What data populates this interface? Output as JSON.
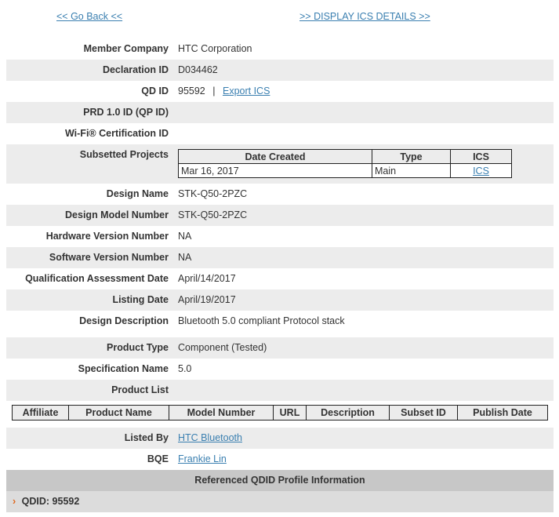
{
  "nav": {
    "back_label": "<< Go Back <<",
    "ics_label": ">> DISPLAY ICS DETAILS >>"
  },
  "fields": {
    "member_company": {
      "label": "Member Company",
      "value": "HTC Corporation"
    },
    "declaration_id": {
      "label": "Declaration ID",
      "value": "D034462"
    },
    "qd_id": {
      "label": "QD ID",
      "value": "95592",
      "separator": "|",
      "export_label": "Export ICS"
    },
    "prd_id": {
      "label": "PRD 1.0 ID (QP ID)",
      "value": ""
    },
    "wifi_cert": {
      "label": "Wi-Fi® Certification ID",
      "value": ""
    },
    "subsetted_projects": {
      "label": "Subsetted Projects"
    },
    "design_name": {
      "label": "Design Name",
      "value": "STK-Q50-2PZC"
    },
    "design_model": {
      "label": "Design Model Number",
      "value": "STK-Q50-2PZC"
    },
    "hw_version": {
      "label": "Hardware Version Number",
      "value": "NA"
    },
    "sw_version": {
      "label": "Software Version Number",
      "value": "NA"
    },
    "qa_date": {
      "label": "Qualification Assessment Date",
      "value": "April/14/2017"
    },
    "listing_date": {
      "label": "Listing Date",
      "value": "April/19/2017"
    },
    "design_desc": {
      "label": "Design Description",
      "value": "Bluetooth 5.0 compliant Protocol stack"
    },
    "product_type": {
      "label": "Product Type",
      "value": "Component (Tested)"
    },
    "spec_name": {
      "label": "Specification Name",
      "value": "5.0"
    },
    "product_list": {
      "label": "Product List"
    },
    "listed_by": {
      "label": "Listed By",
      "value": "HTC Bluetooth"
    },
    "bqe": {
      "label": "BQE",
      "value": "Frankie Lin"
    }
  },
  "subsetted_table": {
    "headers": [
      "Date Created",
      "Type",
      "ICS"
    ],
    "rows": [
      {
        "date": "Mar 16, 2017",
        "type": "Main",
        "ics": "ICS"
      }
    ]
  },
  "product_list_table": {
    "headers": [
      "Affiliate",
      "Product Name",
      "Model Number",
      "URL",
      "Description",
      "Subset ID",
      "Publish Date"
    ]
  },
  "referenced": {
    "title": "Referenced QDID Profile Information",
    "qdid_label": "QDID: 95592",
    "chevron": "›"
  },
  "colors": {
    "link": "#3a7fb0",
    "row_shade": "#ececec",
    "section_header": "#c7c7c7",
    "chevron": "#e0671b"
  }
}
